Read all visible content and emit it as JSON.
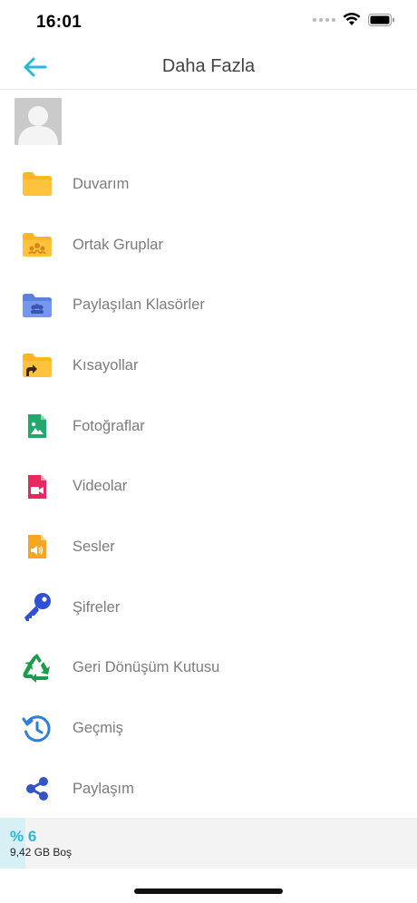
{
  "status": {
    "time": "16:01",
    "icons": [
      "signal-icon",
      "wifi-icon",
      "battery-icon"
    ]
  },
  "header": {
    "title": "Daha Fazla",
    "back_icon": "arrow-left-icon"
  },
  "profile": {
    "avatar_icon": "user-avatar-placeholder"
  },
  "menu": [
    {
      "label": "Duvarım",
      "icon": "folder-icon"
    },
    {
      "label": "Ortak Gruplar",
      "icon": "group-folder-icon"
    },
    {
      "label": "Paylaşılan Klasörler",
      "icon": "shared-folder-icon"
    },
    {
      "label": "Kısayollar",
      "icon": "shortcut-folder-icon"
    },
    {
      "label": "Fotoğraflar",
      "icon": "photo-file-icon"
    },
    {
      "label": "Videolar",
      "icon": "video-file-icon"
    },
    {
      "label": "Sesler",
      "icon": "audio-file-icon"
    },
    {
      "label": "Şifreler",
      "icon": "key-icon"
    },
    {
      "label": "Geri Dönüşüm Kutusu",
      "icon": "recycle-icon"
    },
    {
      "label": "Geçmiş",
      "icon": "history-icon"
    },
    {
      "label": "Paylaşım",
      "icon": "share-icon"
    }
  ],
  "storage": {
    "percent_label": "% 6",
    "percent_used": 6,
    "free_label": "9,42 GB Boş"
  },
  "colors": {
    "accent": "#2bb7d6",
    "folder": "#ffb526",
    "shared_folder": "#6c8ce8",
    "photo": "#21a86a",
    "video": "#e8295f",
    "key": "#2e4fd6",
    "recycle": "#1a9c4a",
    "history": "#2d7fd9",
    "share": "#3554c4"
  }
}
